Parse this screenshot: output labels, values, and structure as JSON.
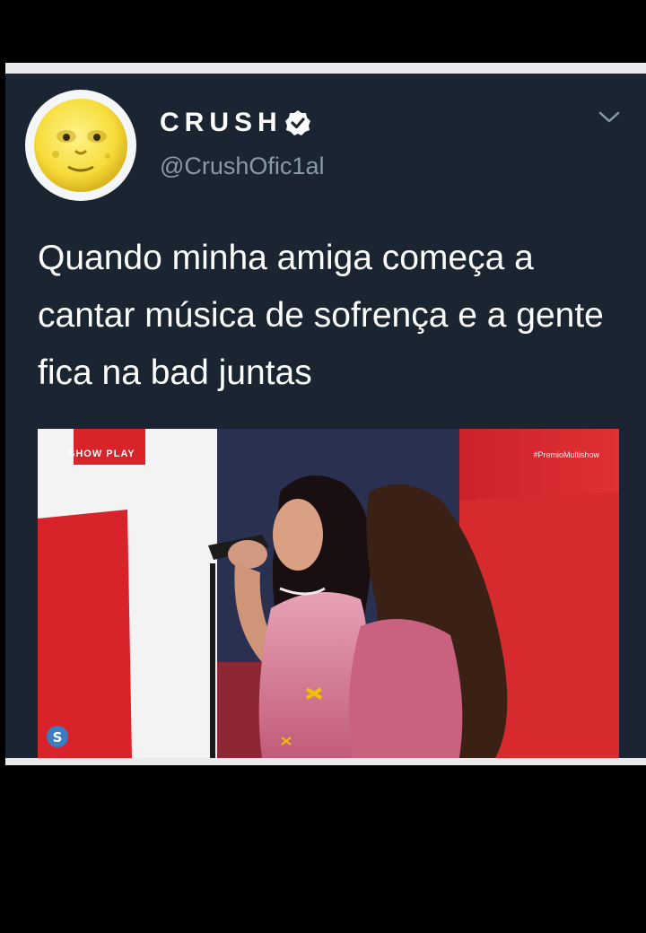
{
  "tweet": {
    "display_name": "CRUSH",
    "handle": "@CrushOfic1al",
    "text": "Quando minha amiga começa a cantar música de sofrença e a gente fica na bad juntas",
    "verified": true
  },
  "media": {
    "broadcast_tag": "SHOW PLAY",
    "watermark": "#PremioMultishow",
    "corner_badge": "S"
  },
  "icons": {
    "avatar": "moon-face-icon",
    "verified": "verified-badge-icon",
    "menu": "chevron-down-icon"
  },
  "colors": {
    "card_background": "#1b2532",
    "handle_gray": "#8899a8",
    "stage_red": "#d8232a"
  }
}
